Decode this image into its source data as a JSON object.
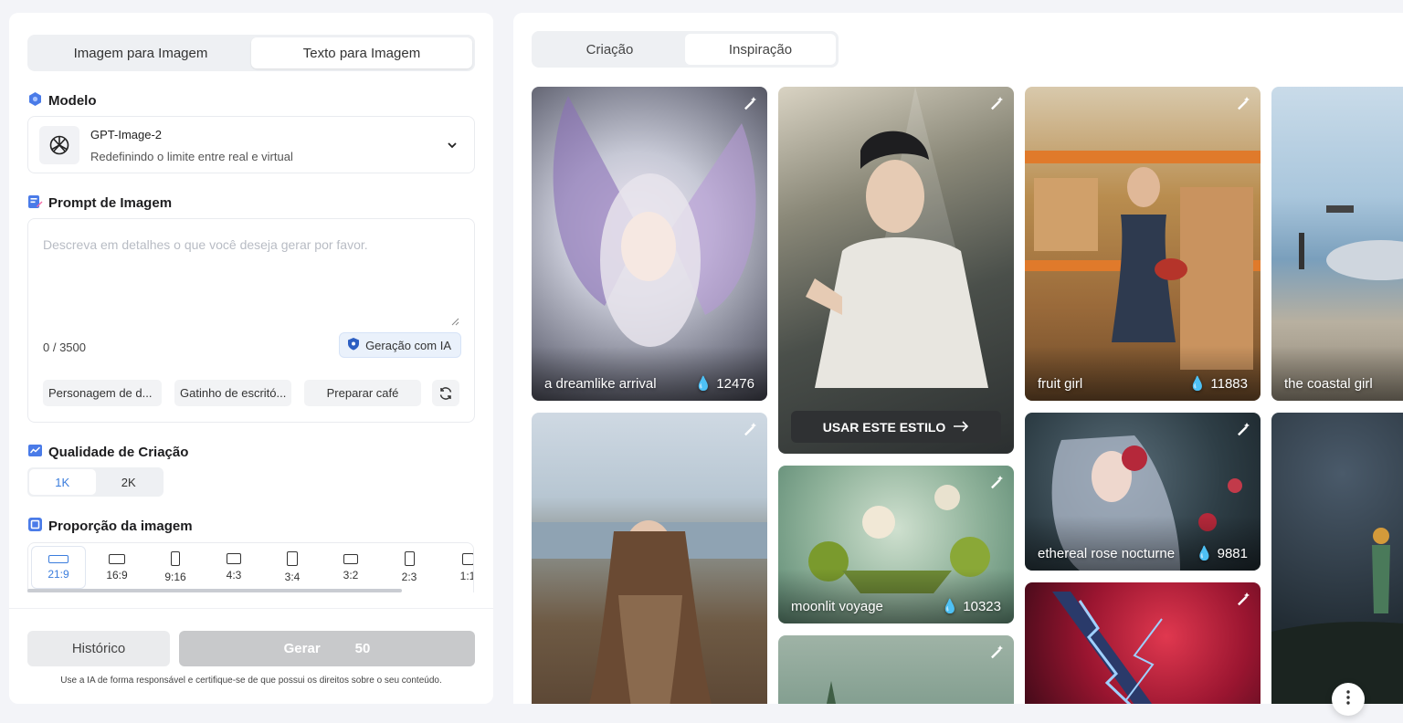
{
  "mode_tabs": {
    "image_to_image": "Imagem para Imagem",
    "text_to_image": "Texto para Imagem"
  },
  "model": {
    "section_title": "Modelo",
    "name": "GPT-Image-2",
    "description": "Redefinindo o limite entre real e virtual"
  },
  "prompt": {
    "section_title": "Prompt de Imagem",
    "placeholder": "Descreva em detalhes o que você deseja gerar por favor.",
    "char_count": "0 / 3500",
    "ai_button": "Geração com IA",
    "chips": [
      "Personagem de d...",
      "Gatinho de escritó...",
      "Preparar café"
    ]
  },
  "quality": {
    "section_title": "Qualidade de Criação",
    "options": [
      "1K",
      "2K"
    ],
    "selected": "1K"
  },
  "ratio": {
    "section_title": "Proporção da imagem",
    "options": [
      "21:9",
      "16:9",
      "9:16",
      "4:3",
      "3:4",
      "3:2",
      "2:3",
      "1:1"
    ],
    "selected": "21:9"
  },
  "footer": {
    "history_button": "Histórico",
    "generate_button": "Gerar",
    "generate_cost": "50",
    "disclaimer": "Use a IA de forma responsável e certifique-se de que possui os direitos sobre o seu conteúdo."
  },
  "gallery": {
    "tabs": [
      "Criação",
      "Inspiração"
    ],
    "active_tab": "Inspiração",
    "use_style_button": "USAR ESTE ESTILO",
    "cards": [
      {
        "title": "a dreamlike arrival",
        "likes": "12476"
      },
      {
        "title": "",
        "likes": ""
      },
      {
        "title": "fruit girl",
        "likes": "11883"
      },
      {
        "title": "the coastal girl",
        "likes": ""
      },
      {
        "title": "",
        "likes": ""
      },
      {
        "title": "moonlit voyage",
        "likes": "10323"
      },
      {
        "title": "ethereal rose nocturne",
        "likes": "9881"
      },
      {
        "title": "",
        "likes": ""
      },
      {
        "title": "",
        "likes": ""
      },
      {
        "title": "",
        "likes": ""
      }
    ]
  },
  "colors": {
    "accent": "#3b7ddd",
    "generate_disabled": "#c8c9cb",
    "panel_bg": "#ffffff",
    "page_bg": "#f3f4f8"
  }
}
